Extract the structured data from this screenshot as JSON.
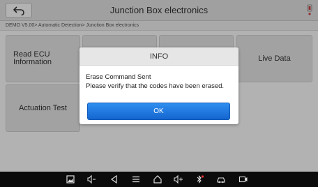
{
  "header": {
    "title": "Junction Box electronics"
  },
  "breadcrumb": {
    "text": "DEMO V5.00> Automatic Detection> Junction Box electronics"
  },
  "tiles": {
    "read_ecu_line1": "Read ECU",
    "read_ecu_line2": "Information",
    "live_data": "Live Data",
    "actuation_test": "Actuation Test"
  },
  "dialog": {
    "title": "INFO",
    "message_line1": "Erase Command Sent",
    "message_line2": "Please verify that the codes have been erased.",
    "ok_label": "OK"
  },
  "navbar": {
    "icons": [
      "screenshot-icon",
      "volume-down-icon",
      "back-icon",
      "menu-icon",
      "home-icon",
      "volume-up-icon",
      "bluetooth-icon",
      "vci-icon",
      "video-record-icon"
    ]
  },
  "colors": {
    "accent": "#1e78e0",
    "navbar": "#0b0b0b",
    "header": "#e6e6e6"
  }
}
